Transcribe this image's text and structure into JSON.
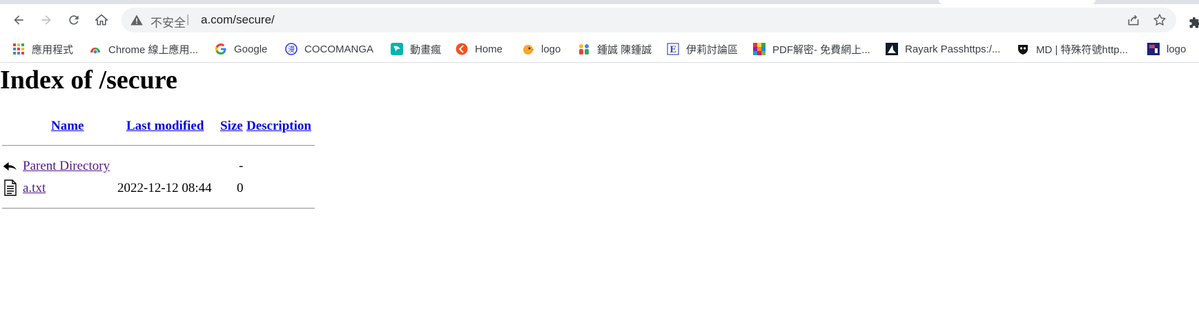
{
  "browser": {
    "address_bar": {
      "security_label": "不安全",
      "separator": "|",
      "url": "a.com/secure/"
    },
    "bookmarks": [
      {
        "label": "應用程式",
        "icon": "apps-grid-icon"
      },
      {
        "label": "Chrome 線上應用...",
        "icon": "chrome-webstore-icon"
      },
      {
        "label": "Google",
        "icon": "google-icon"
      },
      {
        "label": "COCOMANGA",
        "icon": "cocomanga-icon"
      },
      {
        "label": "動畫瘋",
        "icon": "anime-icon"
      },
      {
        "label": "Home",
        "icon": "home-site-icon"
      },
      {
        "label": "logo",
        "icon": "bird-logo-icon"
      },
      {
        "label": "鍾誠 陳鍾誠",
        "icon": "profile-site-icon"
      },
      {
        "label": "伊莉討論區",
        "icon": "eyny-icon"
      },
      {
        "label": "PDF解密- 免費網上...",
        "icon": "pdf-colorful-icon"
      },
      {
        "label": "Rayark Passhttps:/...",
        "icon": "rayark-icon"
      },
      {
        "label": "MD | 特殊符號http...",
        "icon": "md-icon"
      },
      {
        "label": "logo",
        "icon": "red-logo-icon"
      }
    ]
  },
  "page": {
    "title": "Index of /secure",
    "columns": {
      "name": "Name",
      "last_modified": "Last modified",
      "size": "Size",
      "description": "Description"
    },
    "rows": [
      {
        "name": "Parent Directory",
        "last_modified": "",
        "size": "-",
        "description": "",
        "icon": "back-arrow-icon"
      },
      {
        "name": "a.txt",
        "last_modified": "2022-12-12 08:44",
        "size": "0",
        "description": "",
        "icon": "text-file-icon"
      }
    ]
  }
}
